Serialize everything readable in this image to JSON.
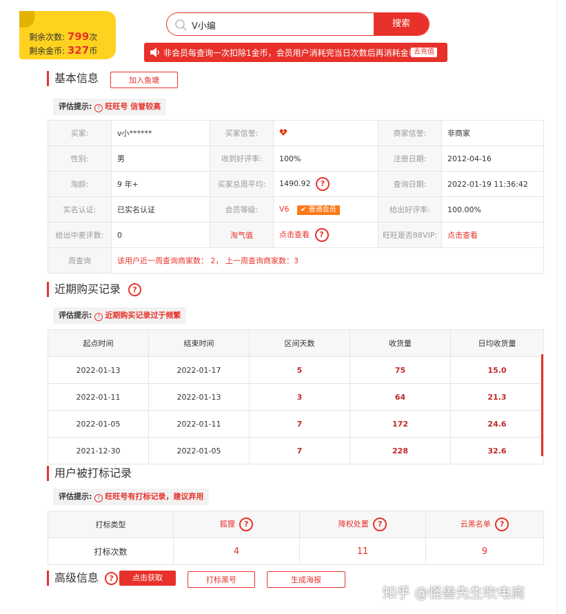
{
  "quota": {
    "times_label": "剩余次数:",
    "times_value": "799",
    "times_unit": "次",
    "coins_label": "剩余金币:",
    "coins_value": "327",
    "coins_unit": "币"
  },
  "search": {
    "value": "V小编",
    "button": "搜索"
  },
  "notice": {
    "text": "非会员每查询一次扣除1金币，会员用户消耗完当日次数后再消耗金币。",
    "recharge": "去充值"
  },
  "basic": {
    "title": "基本信息",
    "add_button": "加入鱼塘",
    "tip_label": "评估提示:",
    "tip_text": "旺旺号 信誉较高",
    "rows": [
      {
        "k1": "买家:",
        "v1": "v小******",
        "k2": "买家信誉:",
        "v2": "",
        "k3": "商家信誉:",
        "v3": "非商家"
      },
      {
        "k1": "性别:",
        "v1": "男",
        "k2": "收到好评率:",
        "v2": "100%",
        "k3": "注册日期:",
        "v3": "2012-04-16"
      },
      {
        "k1": "淘龄:",
        "v1": "9 年+",
        "k2": "买家总周平均:",
        "v2": "1490.92",
        "k3": "查询日期:",
        "v3": "2022-01-19 11:36:42"
      },
      {
        "k1": "实名认证:",
        "v1": "已实名认证",
        "k2": "会员等级:",
        "v2": "V6",
        "k3": "给出好评率:",
        "v3": "100.00%"
      },
      {
        "k1": "给出中差评数:",
        "v1": "0",
        "k2": "淘气值",
        "v2": "点击查看",
        "k3": "旺旺是否88VIP:",
        "v3": "点击查看"
      }
    ],
    "member_badge": "普通会员",
    "weekly_label": "周查询",
    "weekly_text": "该用户近一周查询商家数： 2， 上一周查询商家数：3"
  },
  "purchase": {
    "title": "近期购买记录",
    "tip_label": "评估提示:",
    "tip_text": "近期购买记录过于频繁",
    "headers": [
      "起点时间",
      "结束时间",
      "区间天数",
      "收货量",
      "日均收货量"
    ],
    "rows": [
      [
        "2022-01-13",
        "2022-01-17",
        "5",
        "75",
        "15.0"
      ],
      [
        "2022-01-11",
        "2022-01-13",
        "3",
        "64",
        "21.3"
      ],
      [
        "2022-01-05",
        "2022-01-11",
        "7",
        "172",
        "24.6"
      ],
      [
        "2021-12-30",
        "2022-01-05",
        "7",
        "228",
        "32.6"
      ]
    ]
  },
  "flags": {
    "title": "用户被打标记录",
    "tip_label": "评估提示:",
    "tip_text": "旺旺号有打标记录，建议弃用",
    "header": [
      "打标类型",
      "狐狸",
      "降权处置",
      "云黑名单"
    ],
    "row": [
      "打标次数",
      "4",
      "11",
      "9"
    ]
  },
  "advanced": {
    "title": "高级信息",
    "get_button": "点击获取",
    "blacklist_button": "打标黑号",
    "poster_button": "生成海报"
  },
  "watermark": "知乎 @怪兽先生吹电商",
  "colors": {
    "accent": "#e8312a",
    "quota_bg": "#ffd21f",
    "badge": "#ff7a1a"
  }
}
